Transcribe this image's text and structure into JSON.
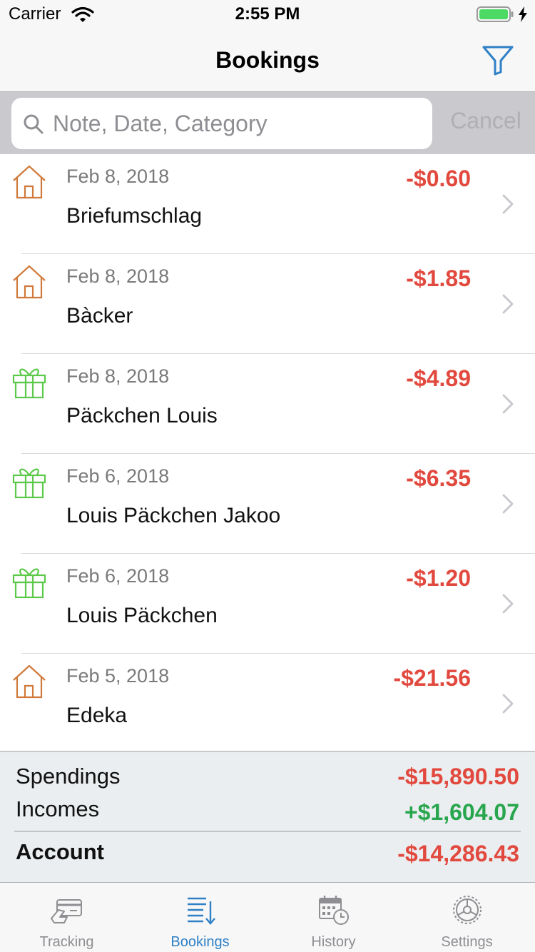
{
  "status_bar": {
    "carrier": "Carrier",
    "time": "2:55 PM"
  },
  "nav": {
    "title": "Bookings"
  },
  "search": {
    "placeholder": "Note, Date, Category",
    "value": "",
    "cancel_label": "Cancel"
  },
  "bookings": [
    {
      "icon": "house-icon",
      "date": "Feb 8, 2018",
      "note": "Briefumschlag",
      "amount": "-$0.60"
    },
    {
      "icon": "house-icon",
      "date": "Feb 8, 2018",
      "note": "Bàcker",
      "amount": "-$1.85"
    },
    {
      "icon": "gift-icon",
      "date": "Feb 8, 2018",
      "note": "Päckchen Louis",
      "amount": "-$4.89"
    },
    {
      "icon": "gift-icon",
      "date": "Feb 6, 2018",
      "note": "Louis Päckchen Jakoo",
      "amount": "-$6.35"
    },
    {
      "icon": "gift-icon",
      "date": "Feb 6, 2018",
      "note": "Louis Päckchen",
      "amount": "-$1.20"
    },
    {
      "icon": "house-icon",
      "date": "Feb 5, 2018",
      "note": "Edeka",
      "amount": "-$21.56"
    }
  ],
  "summary": {
    "spendings_label": "Spendings",
    "spendings_value": "-$15,890.50",
    "incomes_label": "Incomes",
    "incomes_value": "+$1,604.07",
    "account_label": "Account",
    "account_value": "-$14,286.43"
  },
  "tabs": [
    {
      "label": "Tracking",
      "icon": "card-icon",
      "active": false
    },
    {
      "label": "Bookings",
      "icon": "list-icon",
      "active": true
    },
    {
      "label": "History",
      "icon": "calendar-clock-icon",
      "active": false
    },
    {
      "label": "Settings",
      "icon": "gear-icon",
      "active": false
    }
  ],
  "colors": {
    "accent": "#2f80c6",
    "negative": "#e2493e",
    "positive": "#27a64e",
    "house_icon": "#d0793a",
    "gift_icon": "#5cc94a"
  }
}
